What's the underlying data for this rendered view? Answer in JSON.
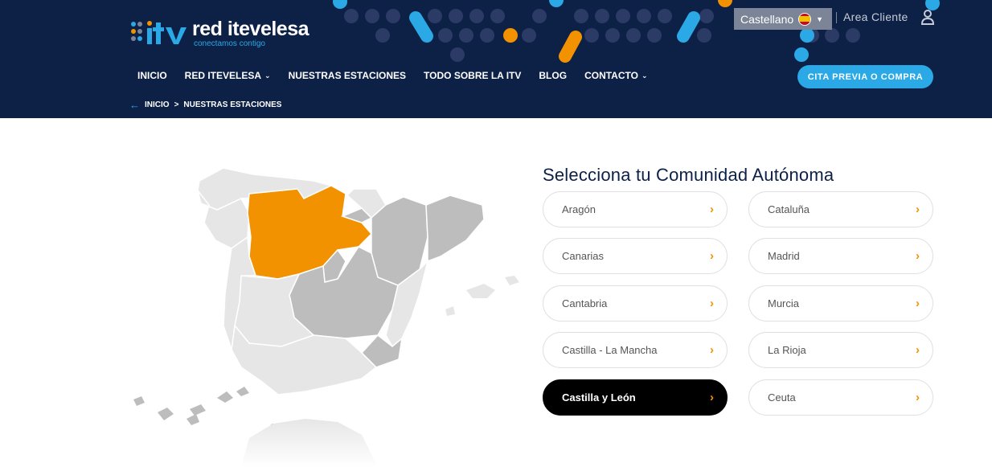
{
  "header": {
    "logo": {
      "name_part1": "red ",
      "name_part2": "itevelesa",
      "tagline": "conectamos contigo"
    },
    "language": {
      "label": "Castellano"
    },
    "area_cliente": "Area Cliente",
    "nav": [
      {
        "label": "INICIO",
        "dropdown": false
      },
      {
        "label": "RED ITEVELESA",
        "dropdown": true
      },
      {
        "label": "NUESTRAS ESTACIONES",
        "dropdown": false
      },
      {
        "label": "TODO SOBRE LA ITV",
        "dropdown": false
      },
      {
        "label": "BLOG",
        "dropdown": false
      },
      {
        "label": "CONTACTO",
        "dropdown": true
      }
    ],
    "cta": "CITA PREVIA O COMPRA",
    "breadcrumb": {
      "home": "INICIO",
      "separator": ">",
      "current": "NUESTRAS ESTACIONES"
    }
  },
  "selector": {
    "title": "Selecciona tu Comunidad Autónoma",
    "left_column": [
      "Aragón",
      "Canarias",
      "Cantabria",
      "Castilla - La Mancha",
      "Castilla y León"
    ],
    "right_column": [
      "Cataluña",
      "Madrid",
      "Murcia",
      "La Rioja",
      "Ceuta"
    ],
    "selected": "Castilla y León"
  },
  "colors": {
    "header_bg": "#0d2046",
    "accent_blue": "#2aa9e6",
    "accent_orange": "#f39200",
    "map_light": "#e6e6e6",
    "map_mid": "#bdbdbd",
    "selected_bg": "#000000"
  },
  "icons": {
    "back": "arrow-left-icon",
    "chevron": "chevron-right-icon",
    "user": "user-icon",
    "flag": "spain-flag-icon"
  }
}
